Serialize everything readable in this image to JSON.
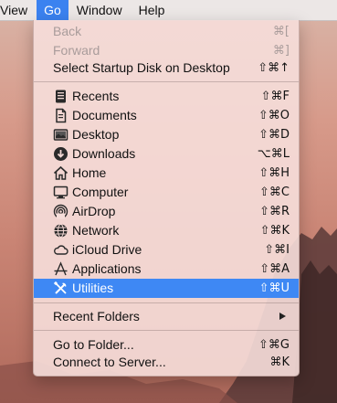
{
  "menubar": {
    "items": [
      "View",
      "Go",
      "Window",
      "Help"
    ],
    "active": "Go"
  },
  "menu": {
    "items": [
      {
        "label": "Back",
        "shortcut": "⌘[",
        "disabled": true
      },
      {
        "label": "Forward",
        "shortcut": "⌘]",
        "disabled": true
      },
      {
        "label": "Select Startup Disk on Desktop",
        "shortcut": "⇧⌘↑"
      },
      {
        "label": "Recents",
        "shortcut": "⇧⌘F",
        "icon": "recents-icon"
      },
      {
        "label": "Documents",
        "shortcut": "⇧⌘O",
        "icon": "documents-icon"
      },
      {
        "label": "Desktop",
        "shortcut": "⇧⌘D",
        "icon": "desktop-icon"
      },
      {
        "label": "Downloads",
        "shortcut": "⌥⌘L",
        "icon": "downloads-icon"
      },
      {
        "label": "Home",
        "shortcut": "⇧⌘H",
        "icon": "home-icon"
      },
      {
        "label": "Computer",
        "shortcut": "⇧⌘C",
        "icon": "computer-icon"
      },
      {
        "label": "AirDrop",
        "shortcut": "⇧⌘R",
        "icon": "airdrop-icon"
      },
      {
        "label": "Network",
        "shortcut": "⇧⌘K",
        "icon": "network-icon"
      },
      {
        "label": "iCloud Drive",
        "shortcut": "⇧⌘I",
        "icon": "icloud-drive-icon"
      },
      {
        "label": "Applications",
        "shortcut": "⇧⌘A",
        "icon": "applications-icon"
      },
      {
        "label": "Utilities",
        "shortcut": "⇧⌘U",
        "icon": "utilities-icon",
        "selected": true
      },
      {
        "label": "Recent Folders",
        "submenu": true
      },
      {
        "label": "Go to Folder...",
        "shortcut": "⇧⌘G"
      },
      {
        "label": "Connect to Server...",
        "shortcut": "⌘K"
      }
    ]
  },
  "colors": {
    "highlight": "#3e88f4",
    "menubar_active": "#3b82f0"
  }
}
